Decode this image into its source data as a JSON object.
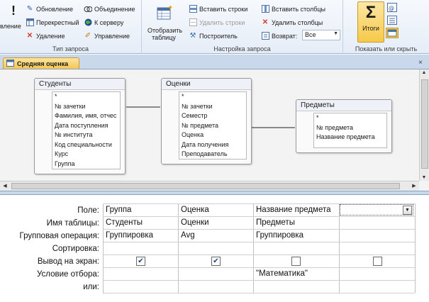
{
  "ribbon": {
    "query_type": {
      "partial_label": "вление",
      "items": [
        "Обновление",
        "Перекрестный",
        "Удаление",
        "Объединение",
        "К серверу",
        "Управление"
      ],
      "group_label": "Тип запроса"
    },
    "query_setup": {
      "show_table": "Отобразить таблицу",
      "items": [
        "Вставить строки",
        "Удалить строки",
        "Построитель",
        "Вставить столбцы",
        "Удалить столбцы"
      ],
      "return_label": "Возврат:",
      "return_value": "Все",
      "group_label": "Настройка запроса"
    },
    "show_hide": {
      "totals": "Итоги",
      "group_label": "Показать или скрыть"
    }
  },
  "document": {
    "tab_title": "Средняя оценка",
    "close": "×"
  },
  "tables": [
    {
      "title": "Студенты",
      "fields": [
        "*",
        "№ зачетки",
        "Фамилия, имя, отчес",
        "Дата поступления",
        "№ института",
        "Код специальности",
        "Курс",
        "Группа"
      ],
      "key_index": 1
    },
    {
      "title": "Оценки",
      "fields": [
        "*",
        "№ зачетки",
        "Семестр",
        "№ предмета",
        "Оценка",
        "Дата получения",
        "Преподаватель"
      ],
      "key_index": -1
    },
    {
      "title": "Предметы",
      "fields": [
        "*",
        "№ предмета",
        "Название предмета"
      ],
      "key_index": 1
    }
  ],
  "grid": {
    "row_labels": [
      "Поле:",
      "Имя таблицы:",
      "Групповая операция:",
      "Сортировка:",
      "Вывод на экран:",
      "Условие отбора:",
      "или:"
    ],
    "columns": [
      {
        "field": "Группа",
        "table": "Студенты",
        "total": "Группировка",
        "sort": "",
        "show": true,
        "criteria": "",
        "or": ""
      },
      {
        "field": "Оценка",
        "table": "Оценки",
        "total": "Avg",
        "sort": "",
        "show": true,
        "criteria": "",
        "or": ""
      },
      {
        "field": "Название предмета",
        "table": "Предметы",
        "total": "Группировка",
        "sort": "",
        "show": false,
        "criteria": "\"Математика\"",
        "or": ""
      },
      {
        "field": "",
        "table": "",
        "total": "",
        "sort": "",
        "show": false,
        "criteria": "",
        "or": ""
      }
    ]
  },
  "colors": {
    "ribbon_bg": "#e6edf7",
    "tab_gold": "#f6c750",
    "totals_active": "#f7c948"
  }
}
